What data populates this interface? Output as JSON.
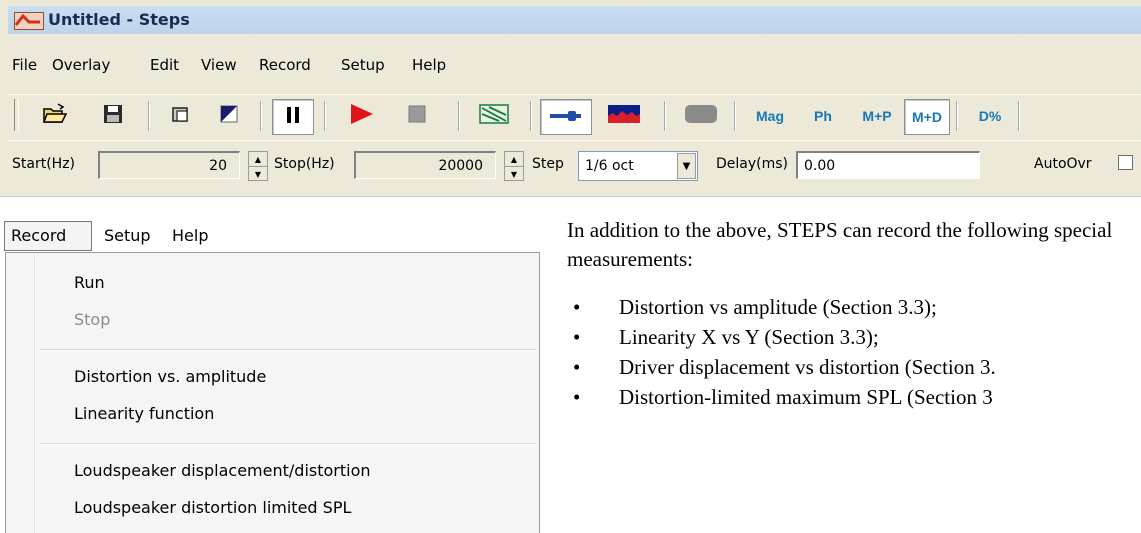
{
  "window": {
    "title": "Untitled - Steps"
  },
  "menubar": {
    "items": [
      "File",
      "Overlay",
      "Edit",
      "View",
      "Record",
      "Setup",
      "Help"
    ]
  },
  "toolbar": {
    "icons": [
      "open-folder-icon",
      "save-disk-icon",
      "copy-icon",
      "contrast-icon",
      "pause-icon",
      "play-icon",
      "stop-icon",
      "sweep-chart-icon",
      "probe-icon",
      "spectrum-icon",
      "blank-icon"
    ],
    "text_buttons": [
      "Mag",
      "Ph",
      "M+P",
      "M+D",
      "D%"
    ],
    "colors": {
      "accent_text": "#1778b8",
      "play": "#e0131b"
    }
  },
  "params": {
    "start_label": "Start(Hz)",
    "start_value": "20",
    "stop_label": "Stop(Hz)",
    "stop_value": "20000",
    "step_label": "Step",
    "step_value": "1/6 oct",
    "delay_label": "Delay(ms)",
    "delay_value": "0.00",
    "autoovr_label": "AutoOvr"
  },
  "record_menu": {
    "bar": [
      "Record",
      "Setup",
      "Help"
    ],
    "items": [
      "Run",
      "Stop",
      "Distortion vs. amplitude",
      "Linearity function",
      "Loudspeaker displacement/distortion",
      "Loudspeaker distortion limited SPL"
    ]
  },
  "doc": {
    "intro": "In addition to the above, STEPS can record the following special measurements:",
    "bullet": "•",
    "bullets": [
      "Distortion vs amplitude (Section 3.3);",
      "Linearity X vs Y (Section 3.3);",
      "Driver displacement vs distortion (Section 3.",
      "Distortion-limited maximum SPL (Section 3"
    ]
  }
}
